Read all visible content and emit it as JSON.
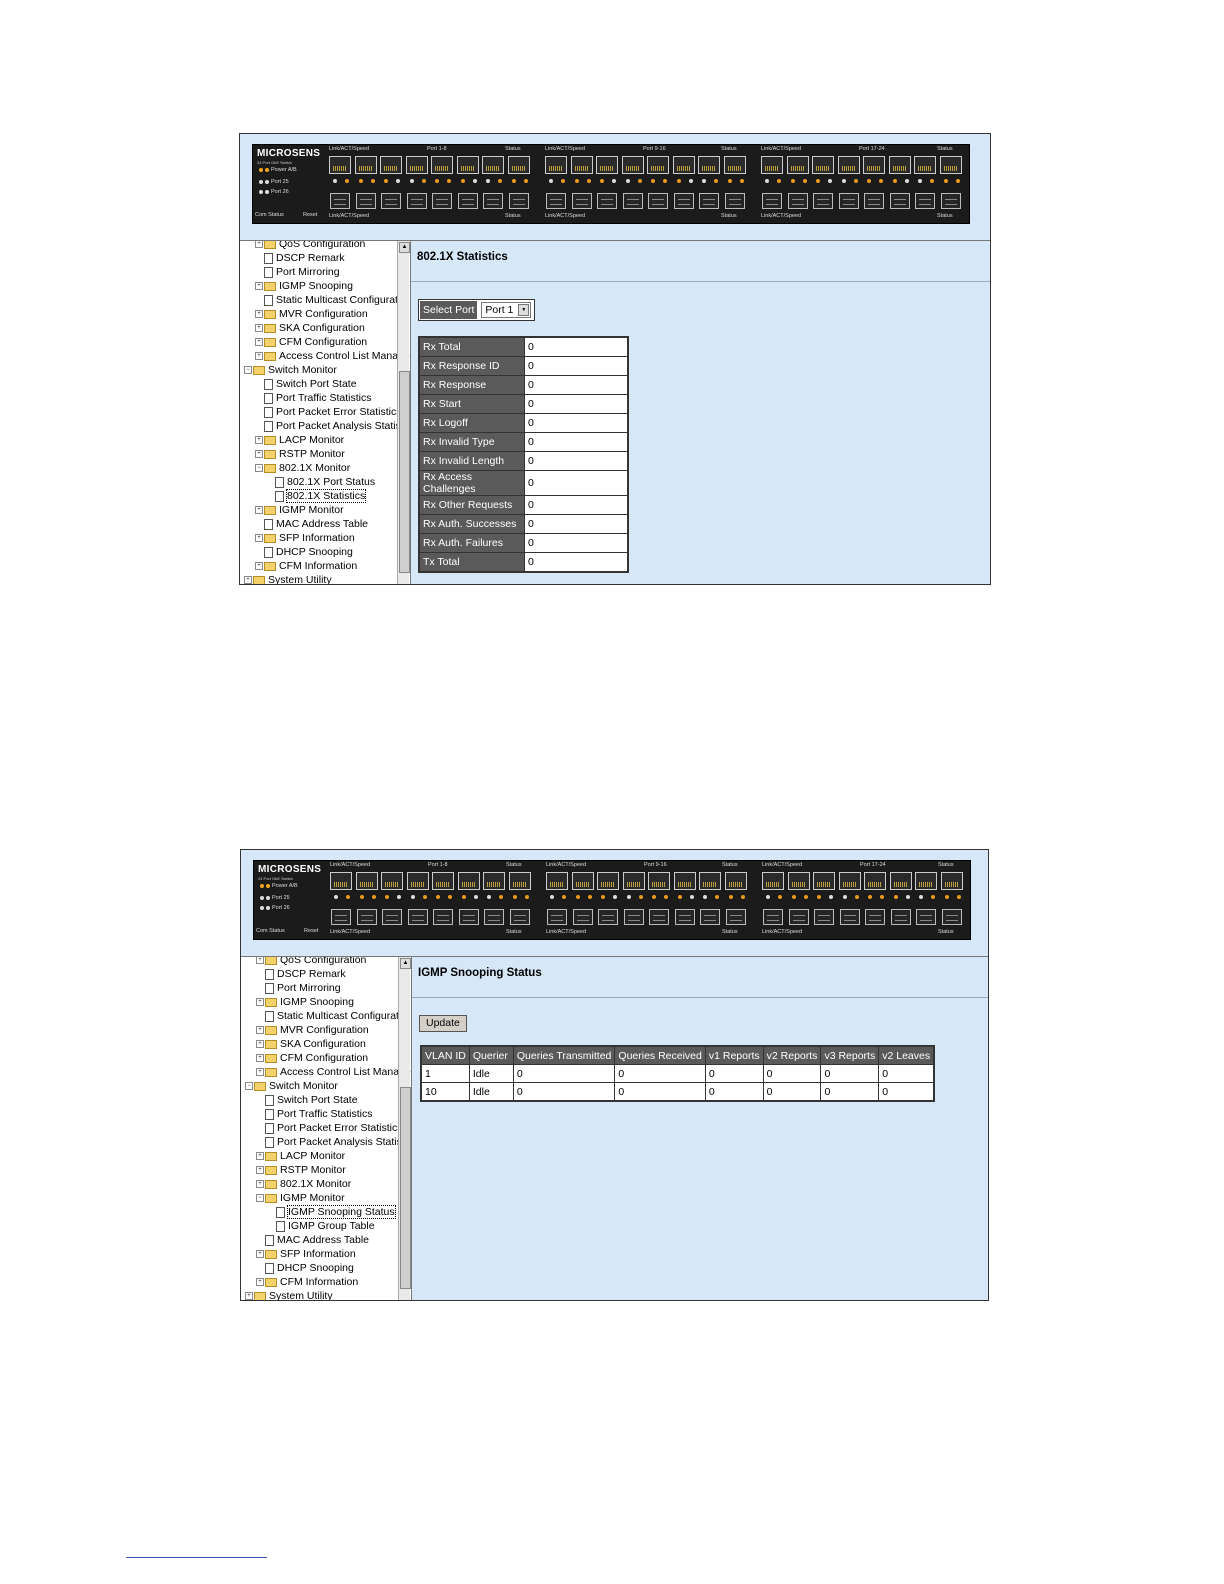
{
  "device": {
    "brand": "MICROSENS",
    "model": "24 Port GbE Switch",
    "leds": [
      "Power A/B",
      "Port 25",
      "Port 26"
    ],
    "bottom_labels": "Com  Status",
    "reset": "Reset",
    "groups": [
      {
        "top_left": "Link/ACT/Speed",
        "top_mid": "Port 1-8",
        "top_right": "Status",
        "bottom_left": "Link/ACT/Speed",
        "bottom_right": "Status"
      },
      {
        "top_left": "Link/ACT/Speed",
        "top_mid": "Port 9-16",
        "top_right": "Status",
        "bottom_left": "Link/ACT/Speed",
        "bottom_right": "Status"
      },
      {
        "top_left": "Link/ACT/Speed",
        "top_mid": "Port 17-24",
        "top_right": "Status",
        "bottom_left": "Link/ACT/Speed",
        "bottom_right": "Status"
      }
    ]
  },
  "screens": [
    {
      "nav": [
        {
          "label": "QoS Configuration",
          "type": "folder",
          "level": 1,
          "pm": "+"
        },
        {
          "label": "DSCP Remark",
          "type": "doc",
          "level": 1
        },
        {
          "label": "Port Mirroring",
          "type": "doc",
          "level": 1
        },
        {
          "label": "IGMP Snooping",
          "type": "folder",
          "level": 1,
          "pm": "+"
        },
        {
          "label": "Static Multicast Configuratio",
          "type": "doc",
          "level": 1
        },
        {
          "label": "MVR Configuration",
          "type": "folder",
          "level": 1,
          "pm": "+"
        },
        {
          "label": "SKA Configuration",
          "type": "folder",
          "level": 1,
          "pm": "+"
        },
        {
          "label": "CFM Configuration",
          "type": "folder",
          "level": 1,
          "pm": "+"
        },
        {
          "label": "Access Control List Manage",
          "type": "folder",
          "level": 1,
          "pm": "+"
        },
        {
          "label": "Switch Monitor",
          "type": "folder",
          "level": 0,
          "pm": "-"
        },
        {
          "label": "Switch Port State",
          "type": "doc",
          "level": 1
        },
        {
          "label": "Port Traffic Statistics",
          "type": "doc",
          "level": 1
        },
        {
          "label": "Port Packet Error Statistics",
          "type": "doc",
          "level": 1
        },
        {
          "label": "Port Packet Analysis Statist",
          "type": "doc",
          "level": 1
        },
        {
          "label": "LACP Monitor",
          "type": "folder",
          "level": 1,
          "pm": "+"
        },
        {
          "label": "RSTP Monitor",
          "type": "folder",
          "level": 1,
          "pm": "+"
        },
        {
          "label": "802.1X Monitor",
          "type": "folder",
          "level": 1,
          "pm": "-"
        },
        {
          "label": "802.1X Port Status",
          "type": "doc",
          "level": 2
        },
        {
          "label": "802.1X Statistics",
          "type": "doc",
          "level": 2,
          "selected": true
        },
        {
          "label": "IGMP Monitor",
          "type": "folder",
          "level": 1,
          "pm": "+"
        },
        {
          "label": "MAC Address Table",
          "type": "doc",
          "level": 1
        },
        {
          "label": "SFP Information",
          "type": "folder",
          "level": 1,
          "pm": "+"
        },
        {
          "label": "DHCP Snooping",
          "type": "doc",
          "level": 1
        },
        {
          "label": "CFM Information",
          "type": "folder",
          "level": 1,
          "pm": "+"
        },
        {
          "label": "System Utility",
          "type": "folder",
          "level": 0,
          "pm": "+"
        }
      ],
      "title": "802.1X Statistics",
      "select_port_label": "Select Port",
      "select_port_value": "Port 1",
      "stats": [
        {
          "key": "Rx Total",
          "value": "0"
        },
        {
          "key": "Rx Response ID",
          "value": "0"
        },
        {
          "key": "Rx Response",
          "value": "0"
        },
        {
          "key": "Rx Start",
          "value": "0"
        },
        {
          "key": "Rx Logoff",
          "value": "0"
        },
        {
          "key": "Rx Invalid Type",
          "value": "0"
        },
        {
          "key": "Rx Invalid Length",
          "value": "0"
        },
        {
          "key": "Rx Access Challenges",
          "value": "0"
        },
        {
          "key": "Rx Other Requests",
          "value": "0"
        },
        {
          "key": "Rx Auth. Successes",
          "value": "0"
        },
        {
          "key": "Rx Auth. Failures",
          "value": "0"
        },
        {
          "key": "Tx Total",
          "value": "0"
        }
      ]
    },
    {
      "nav": [
        {
          "label": "QoS Configuration",
          "type": "folder",
          "level": 1,
          "pm": "+"
        },
        {
          "label": "DSCP Remark",
          "type": "doc",
          "level": 1
        },
        {
          "label": "Port Mirroring",
          "type": "doc",
          "level": 1
        },
        {
          "label": "IGMP Snooping",
          "type": "folder",
          "level": 1,
          "pm": "+"
        },
        {
          "label": "Static Multicast Configuratio",
          "type": "doc",
          "level": 1
        },
        {
          "label": "MVR Configuration",
          "type": "folder",
          "level": 1,
          "pm": "+"
        },
        {
          "label": "SKA Configuration",
          "type": "folder",
          "level": 1,
          "pm": "+"
        },
        {
          "label": "CFM Configuration",
          "type": "folder",
          "level": 1,
          "pm": "+"
        },
        {
          "label": "Access Control List Manage",
          "type": "folder",
          "level": 1,
          "pm": "+"
        },
        {
          "label": "Switch Monitor",
          "type": "folder",
          "level": 0,
          "pm": "-"
        },
        {
          "label": "Switch Port State",
          "type": "doc",
          "level": 1
        },
        {
          "label": "Port Traffic Statistics",
          "type": "doc",
          "level": 1
        },
        {
          "label": "Port Packet Error Statistics",
          "type": "doc",
          "level": 1
        },
        {
          "label": "Port Packet Analysis Statist",
          "type": "doc",
          "level": 1
        },
        {
          "label": "LACP Monitor",
          "type": "folder",
          "level": 1,
          "pm": "+"
        },
        {
          "label": "RSTP Monitor",
          "type": "folder",
          "level": 1,
          "pm": "+"
        },
        {
          "label": "802.1X Monitor",
          "type": "folder",
          "level": 1,
          "pm": "+"
        },
        {
          "label": "IGMP Monitor",
          "type": "folder",
          "level": 1,
          "pm": "-"
        },
        {
          "label": "IGMP Snooping Status",
          "type": "doc",
          "level": 2,
          "selected": true
        },
        {
          "label": "IGMP Group Table",
          "type": "doc",
          "level": 2
        },
        {
          "label": "MAC Address Table",
          "type": "doc",
          "level": 1
        },
        {
          "label": "SFP Information",
          "type": "folder",
          "level": 1,
          "pm": "+"
        },
        {
          "label": "DHCP Snooping",
          "type": "doc",
          "level": 1
        },
        {
          "label": "CFM Information",
          "type": "folder",
          "level": 1,
          "pm": "+"
        },
        {
          "label": "System Utility",
          "type": "folder",
          "level": 0,
          "pm": "+"
        }
      ],
      "title": "IGMP Snooping Status",
      "update_label": "Update",
      "columns": [
        "VLAN ID",
        "Querier",
        "Queries Transmitted",
        "Queries Received",
        "v1 Reports",
        "v2 Reports",
        "v3 Reports",
        "v2 Leaves"
      ],
      "rows": [
        [
          "1",
          "Idle",
          "0",
          "0",
          "0",
          "0",
          "0",
          "0"
        ],
        [
          "10",
          "Idle",
          "0",
          "0",
          "0",
          "0",
          "0",
          "0"
        ]
      ]
    }
  ]
}
